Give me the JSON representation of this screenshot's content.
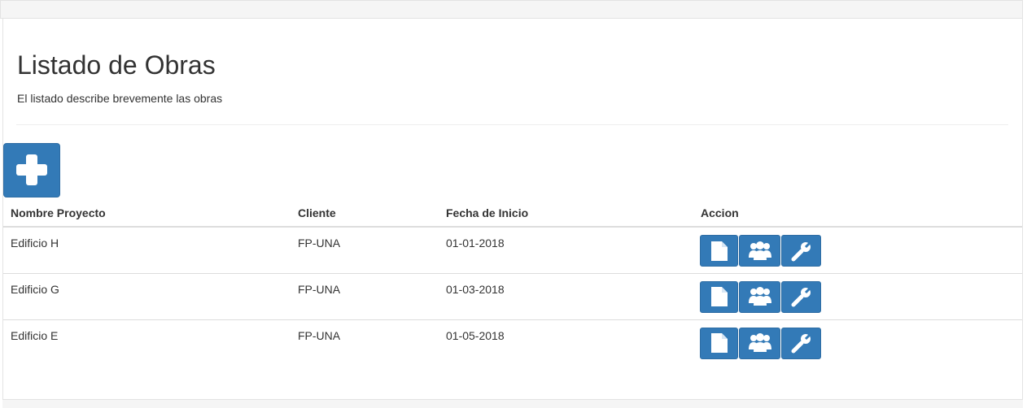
{
  "header": {
    "title": "Listado de Obras",
    "subtitle": "El listado describe brevemente las obras"
  },
  "toolbar": {
    "add_icon": "plus-icon"
  },
  "table": {
    "columns": [
      "Nombre Proyecto",
      "Cliente",
      "Fecha de Inicio",
      "Accion"
    ],
    "rows": [
      {
        "nombre": "Edificio H",
        "cliente": "FP-UNA",
        "fecha": "01-01-2018"
      },
      {
        "nombre": "Edificio G",
        "cliente": "FP-UNA",
        "fecha": "01-03-2018"
      },
      {
        "nombre": "Edificio E",
        "cliente": "FP-UNA",
        "fecha": "01-05-2018"
      }
    ],
    "action_icons": [
      "file-icon",
      "users-icon",
      "wrench-icon"
    ]
  },
  "colors": {
    "primary": "#337ab7",
    "primary_border": "#2e6da4",
    "text": "#333333",
    "border": "#dddddd"
  }
}
